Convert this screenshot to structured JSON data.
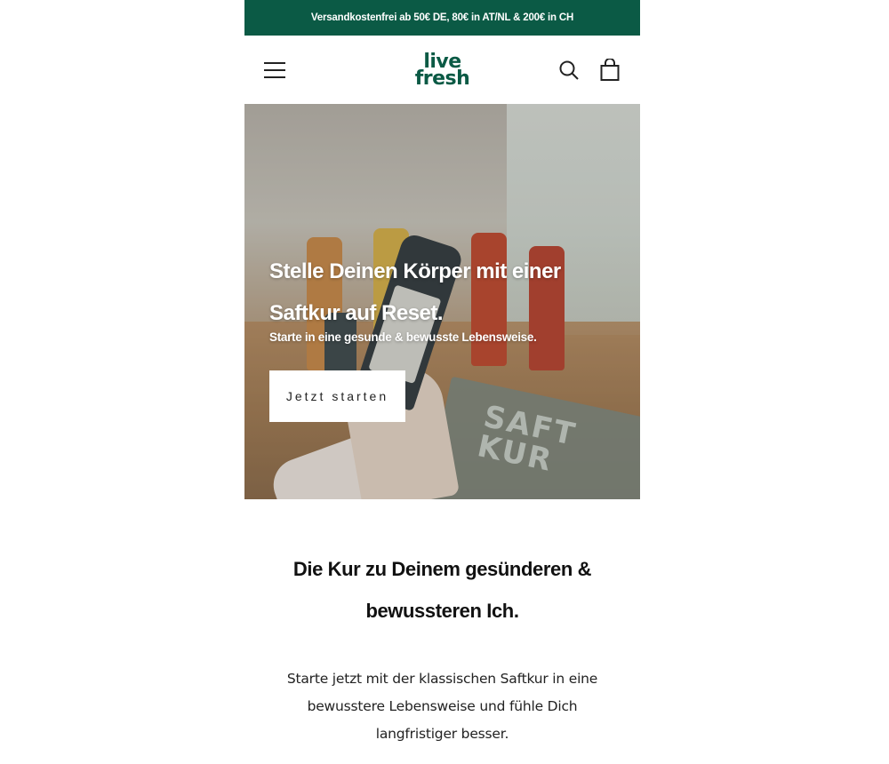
{
  "promo_bar": {
    "text": "Versandkostenfrei ab 50€ DE, 80€ in AT/NL & 200€ in CH"
  },
  "header": {
    "logo_line1": "live",
    "logo_line2": "fresh",
    "menu_icon": "hamburger-menu-icon",
    "search_icon": "search-icon",
    "cart_icon": "shopping-bag-icon"
  },
  "hero": {
    "title": "Stelle Deinen Körper mit einer Saftkur auf Reset.",
    "subtitle": "Starte in eine gesunde & bewusste Lebensweise.",
    "cta_label": "Jetzt starten"
  },
  "intro": {
    "title": "Die Kur zu Deinem gesünderen & bewussteren Ich.",
    "text": "Starte jetzt mit der klassischen Saftkur in eine bewusstere Lebensweise und fühle Dich langfristiger besser."
  },
  "colors": {
    "brand": "#0b5a45",
    "promo_text": "#ffffff",
    "cta_bg": "#ffffff"
  }
}
